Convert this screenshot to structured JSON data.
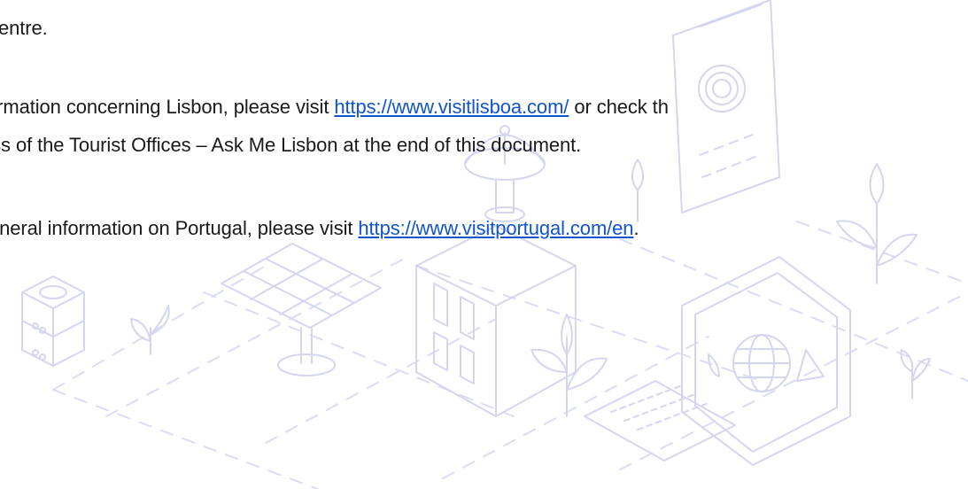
{
  "document": {
    "line1": "entre.",
    "para2": {
      "pre": "formation concerning Lisbon, please visit ",
      "link": "https://www.visitlisboa.com/",
      "post": " or check th",
      "line2": "ess of the Tourist Offices – Ask Me Lisbon at the end of this document."
    },
    "para3": {
      "pre": "eneral information on Portugal, please visit ",
      "link": "https://www.visitportugal.com/en",
      "post": "."
    }
  },
  "style": {
    "link_color": "#1155cc",
    "illustration_color": "#d4d6f0",
    "text_color": "#1a1a1a"
  },
  "illustration": {
    "icons": [
      "satellite-dish-icon",
      "document-fingerprint-icon",
      "solar-panel-icon",
      "building-icon",
      "server-icon",
      "monitor-globe-icon",
      "keyboard-icon",
      "plant-icon"
    ]
  }
}
